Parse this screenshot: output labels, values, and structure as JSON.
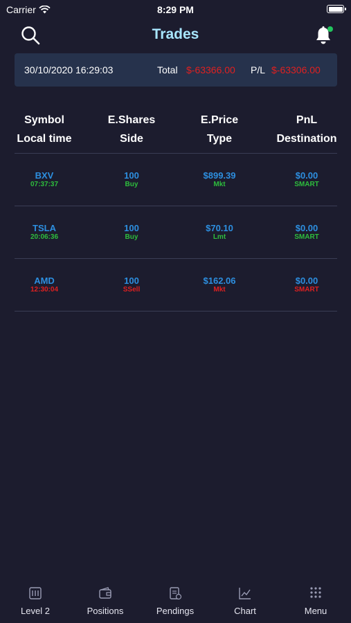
{
  "status_bar": {
    "carrier": "Carrier",
    "time": "8:29 PM"
  },
  "nav": {
    "title": "Trades"
  },
  "summary": {
    "datetime": "30/10/2020  16:29:03",
    "total_label": "Total",
    "total_value": "$-63366.00",
    "pl_label": "P/L",
    "pl_value": "$-63306.00"
  },
  "table": {
    "headers": [
      {
        "top": "Symbol",
        "bottom": "Local time"
      },
      {
        "top": "E.Shares",
        "bottom": "Side"
      },
      {
        "top": "E.Price",
        "bottom": "Type"
      },
      {
        "top": "PnL",
        "bottom": "Destination"
      }
    ],
    "rows": [
      {
        "symbol": "BXV",
        "time": "07:37:37",
        "shares": "100",
        "side": "Buy",
        "price": "$899.39",
        "type": "Mkt",
        "pnl": "$0.00",
        "destination": "SMART"
      },
      {
        "symbol": "TSLA",
        "time": "20:06:36",
        "shares": "100",
        "side": "Buy",
        "price": "$70.10",
        "type": "Lmt",
        "pnl": "$0.00",
        "destination": "SMART"
      },
      {
        "symbol": "AMD",
        "time": "12:30:04",
        "shares": "100",
        "side": "SSell",
        "price": "$162.06",
        "type": "Mkt",
        "pnl": "$0.00",
        "destination": "SMART"
      }
    ]
  },
  "tabs": [
    {
      "label": "Level 2",
      "icon": "level2-icon"
    },
    {
      "label": "Positions",
      "icon": "wallet-icon"
    },
    {
      "label": "Pendings",
      "icon": "pending-icon"
    },
    {
      "label": "Chart",
      "icon": "chart-icon"
    },
    {
      "label": "Menu",
      "icon": "menu-grid-icon"
    }
  ],
  "colors": {
    "background": "#1c1c2e",
    "title": "#a8e6ff",
    "value_blue": "#2d8fe0",
    "buy_green": "#2ebd3d",
    "sell_red": "#e02020",
    "summary_bg": "#26324c"
  }
}
